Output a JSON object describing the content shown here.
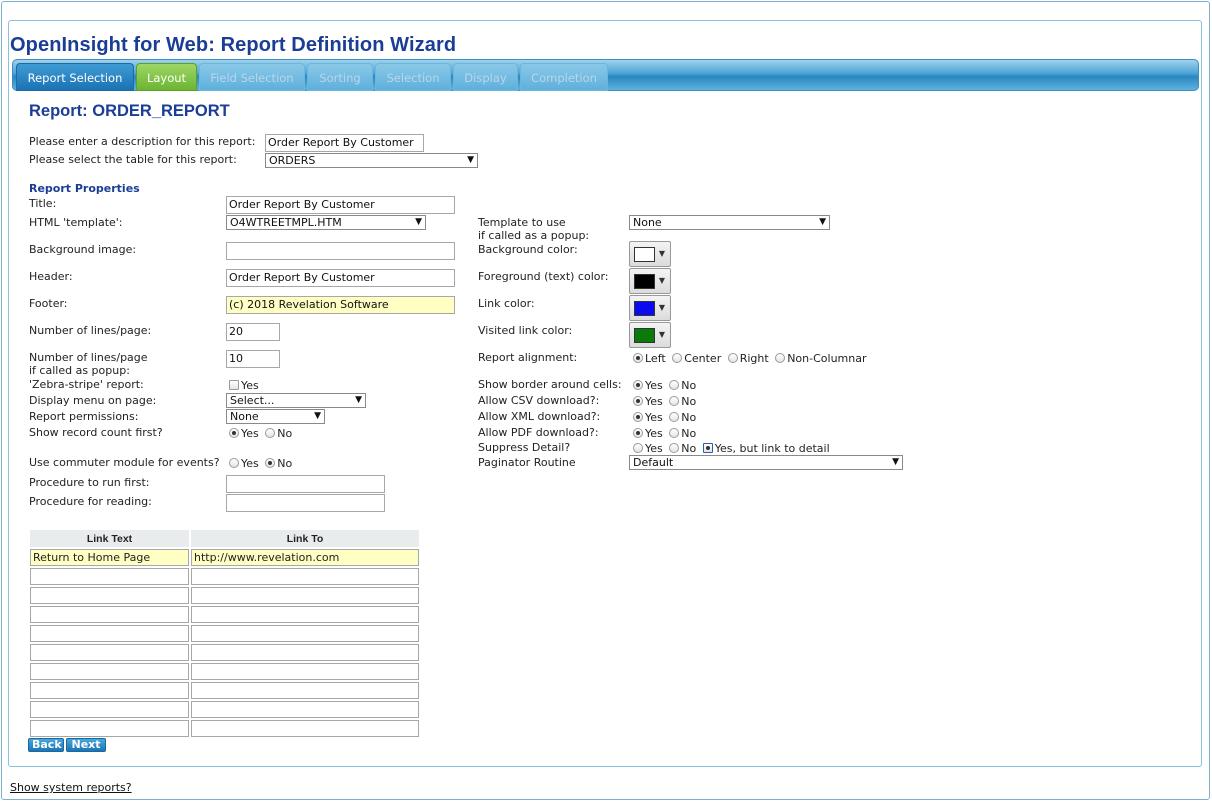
{
  "app_title": "OpenInsight for Web: Report Definition Wizard",
  "tabs": [
    {
      "label": "Report Selection",
      "state": "active"
    },
    {
      "label": "Layout",
      "state": "current"
    },
    {
      "label": "Field Selection",
      "state": "disabled"
    },
    {
      "label": "Sorting",
      "state": "disabled"
    },
    {
      "label": "Selection",
      "state": "disabled"
    },
    {
      "label": "Display",
      "state": "disabled"
    },
    {
      "label": "Completion",
      "state": "disabled"
    }
  ],
  "report_title": "Report: ORDER_REPORT",
  "description": {
    "label": "Please enter a description for this report:",
    "value": "Order Report By Customer"
  },
  "table_select": {
    "label": "Please select the table for this report:",
    "value": "ORDERS"
  },
  "properties": {
    "heading": "Report Properties",
    "title": {
      "label": "Title:",
      "value": "Order Report By Customer"
    },
    "html_template": {
      "label": "HTML 'template':",
      "value": "O4WTREETMPL.HTM"
    },
    "background_image": {
      "label": "Background image:",
      "value": ""
    },
    "header": {
      "label": "Header:",
      "value": "Order Report By Customer"
    },
    "footer": {
      "label": "Footer:",
      "value": "(c) 2018 Revelation Software"
    },
    "lines_per_page": {
      "label": "Number of lines/page:",
      "value": "20"
    },
    "lines_popup": {
      "label_1": "Number of lines/page",
      "label_2": "if called as popup:",
      "value": "10"
    },
    "zebra": {
      "label": "'Zebra-stripe' report:",
      "option": "Yes"
    },
    "display_menu": {
      "label": "Display menu on page:",
      "value": "Select..."
    },
    "permissions": {
      "label": "Report permissions:",
      "value": "None"
    },
    "record_count": {
      "label": "Show record count first?",
      "yes": "Yes",
      "no": "No",
      "selected": "Yes"
    },
    "commuter": {
      "label": "Use commuter module for events?",
      "yes": "Yes",
      "no": "No",
      "selected": "No"
    },
    "proc_first": {
      "label": "Procedure to run first:",
      "value": ""
    },
    "proc_reading": {
      "label": "Procedure for reading:",
      "value": ""
    }
  },
  "right": {
    "template_popup": {
      "label_1": "Template to use",
      "label_2": "if called as a popup:",
      "value": "None"
    },
    "bg_color": {
      "label": "Background color:",
      "color": "#ffffff"
    },
    "fg_color": {
      "label": "Foreground (text) color:",
      "color": "#000000"
    },
    "link_color": {
      "label": "Link color:",
      "color": "#0a0af0"
    },
    "visited_color": {
      "label": "Visited link color:",
      "color": "#0a7a0a"
    },
    "alignment": {
      "label": "Report alignment:",
      "options": [
        "Left",
        "Center",
        "Right",
        "Non-Columnar"
      ],
      "selected": "Left"
    },
    "border": {
      "label": "Show border around cells:",
      "yes": "Yes",
      "no": "No",
      "selected": "Yes"
    },
    "csv": {
      "label": "Allow CSV download?:",
      "yes": "Yes",
      "no": "No",
      "selected": "Yes"
    },
    "xml": {
      "label": "Allow XML download?:",
      "yes": "Yes",
      "no": "No",
      "selected": "Yes"
    },
    "pdf": {
      "label": "Allow PDF download?:",
      "yes": "Yes",
      "no": "No",
      "selected": "Yes"
    },
    "suppress": {
      "label": "Suppress Detail?",
      "options": [
        "Yes",
        "No",
        "Yes, but link to detail"
      ],
      "selected": "Yes, but link to detail"
    },
    "paginator": {
      "label": "Paginator Routine",
      "value": "Default"
    }
  },
  "links_table": {
    "headers": [
      "Link Text",
      "Link To"
    ],
    "rows": [
      [
        "Return to Home Page",
        "http://www.revelation.com"
      ],
      [
        "",
        ""
      ],
      [
        "",
        ""
      ],
      [
        "",
        ""
      ],
      [
        "",
        ""
      ],
      [
        "",
        ""
      ],
      [
        "",
        ""
      ],
      [
        "",
        ""
      ],
      [
        "",
        ""
      ],
      [
        "",
        ""
      ]
    ]
  },
  "buttons": {
    "back": "Back",
    "next": "Next"
  },
  "footer_link": "Show system reports?"
}
